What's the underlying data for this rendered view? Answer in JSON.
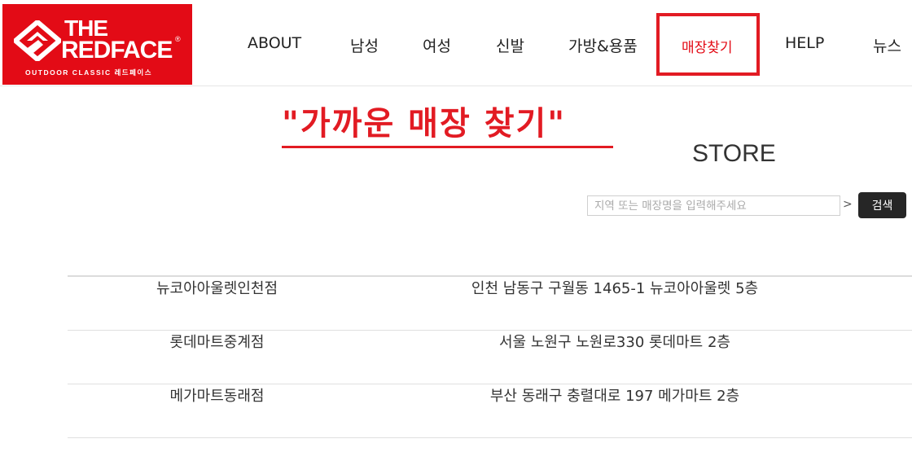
{
  "logo": {
    "the": "THE",
    "brand": "REDFACE",
    "registered": "®",
    "tagline": "OUTDOOR CLASSIC 레드페이스",
    "background_color": "#e30b16"
  },
  "nav": {
    "items": [
      {
        "label": "ABOUT"
      },
      {
        "label": "남성"
      },
      {
        "label": "여성"
      },
      {
        "label": "신발"
      },
      {
        "label": "가방&용품"
      },
      {
        "label": "매장찾기",
        "active": true
      },
      {
        "label": "HELP"
      },
      {
        "label": "뉴스"
      }
    ],
    "active_color": "#e30b16"
  },
  "annotation": {
    "title": "\"가까운 매장 찾기\"",
    "color": "#e21b23"
  },
  "store": {
    "title": "STORE",
    "search": {
      "placeholder": "지역 또는 매장명을 입력해주세요",
      "value": "",
      "arrow": ">",
      "button_label": "검색"
    },
    "rows": [
      {
        "name": "뉴코아아울렛인천점",
        "address": "인천 남동구 구월동 1465-1 뉴코아아울렛 5층"
      },
      {
        "name": "롯데마트중계점",
        "address": "서울 노원구 노원로330 롯데마트 2층"
      },
      {
        "name": "메가마트동래점",
        "address": "부산 동래구 충렬대로 197 메가마트 2층"
      }
    ]
  }
}
